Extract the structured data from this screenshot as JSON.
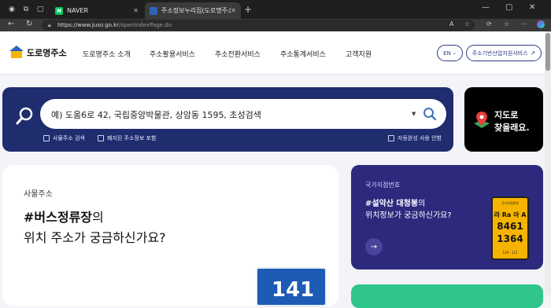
{
  "browser": {
    "tabs": [
      {
        "title": "NAVER",
        "favicon_letter": "N",
        "favicon_color": "#03c75a"
      },
      {
        "title": "주소정보누리집(도로명주소 안내",
        "favicon_color": "#2d64b8"
      }
    ],
    "url_domain": "https://www.juso.go.kr",
    "url_path": "/openIndexPage.do"
  },
  "header": {
    "logo_text": "도로명주소",
    "nav": [
      "도로명주소 소개",
      "주소활용서비스",
      "주소전환서비스",
      "주소통계서비스",
      "고객지원"
    ],
    "lang_label": "EN",
    "biz_label": "주소기반산업지원서비스"
  },
  "search": {
    "placeholder": "예) 도움6로 42, 국립중앙박물관, 상암동 1595, 초성검색",
    "options": [
      "사물주소 검색",
      "폐지된 주소정보 포함",
      "자동완성 사용 안함"
    ]
  },
  "map_card": {
    "line1": "지도로",
    "line2": "찾을래요."
  },
  "object_card": {
    "subtitle": "사물주소",
    "headline_bold": "#버스정류장",
    "headline_rest": "의",
    "headline_line2": "위치 주소가 궁금하신가요?",
    "sign_number": "141"
  },
  "national_card": {
    "subtitle": "국가지점번호",
    "line1_bold": "#설악산 대청봉",
    "line1_rest": "의",
    "line2": "위치정보가 궁금하신가요?",
    "plate_title": "국가지점번호",
    "plate_code": "라 Ra 아 A",
    "plate_num1": "8461",
    "plate_num2": "1364",
    "plate_footer": "119 · 112"
  },
  "colors": {
    "navy": "#1f2c6e",
    "brand_blue": "#2d64b8",
    "accent_yellow": "#f5b400",
    "green": "#2fc58b"
  }
}
